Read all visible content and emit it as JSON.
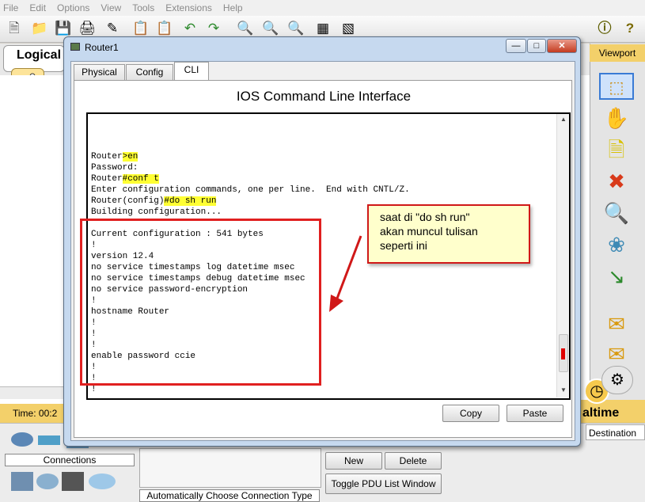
{
  "menu": [
    "File",
    "Edit",
    "Options",
    "View",
    "Tools",
    "Extensions",
    "Help"
  ],
  "workspace": {
    "logical_tab": "Logical",
    "viewport_label": "Viewport",
    "time_label": "Time: 00:2",
    "realtime_label": "altime",
    "destination_label": "Destination",
    "connections_label": "Connections",
    "auto_connection_label": "Automatically Choose Connection Type",
    "new_button": "New",
    "delete_button": "Delete",
    "toggle_pdu_button": "Toggle PDU List Window"
  },
  "window": {
    "title": "Router1",
    "tabs": [
      "Physical",
      "Config",
      "CLI"
    ],
    "active_tab": "CLI",
    "cli_header": "IOS Command Line Interface",
    "copy_button": "Copy",
    "paste_button": "Paste"
  },
  "cli_lines": [
    {
      "prefix": "",
      "hl": "",
      "suffix": ""
    },
    {
      "prefix": "",
      "hl": "",
      "suffix": ""
    },
    {
      "prefix": "",
      "hl": "",
      "suffix": ""
    },
    {
      "prefix": "Router",
      "hl": ">en",
      "suffix": ""
    },
    {
      "prefix": "Password:",
      "hl": "",
      "suffix": ""
    },
    {
      "prefix": "Router",
      "hl": "#conf t",
      "suffix": ""
    },
    {
      "prefix": "Enter configuration commands, one per line.  End with CNTL/Z.",
      "hl": "",
      "suffix": ""
    },
    {
      "prefix": "Router(config)",
      "hl": "#do sh run",
      "suffix": ""
    },
    {
      "prefix": "Building configuration...",
      "hl": "",
      "suffix": ""
    },
    {
      "prefix": "",
      "hl": "",
      "suffix": ""
    },
    {
      "prefix": "Current configuration : 541 bytes",
      "hl": "",
      "suffix": ""
    },
    {
      "prefix": "!",
      "hl": "",
      "suffix": ""
    },
    {
      "prefix": "version 12.4",
      "hl": "",
      "suffix": ""
    },
    {
      "prefix": "no service timestamps log datetime msec",
      "hl": "",
      "suffix": ""
    },
    {
      "prefix": "no service timestamps debug datetime msec",
      "hl": "",
      "suffix": ""
    },
    {
      "prefix": "no service password-encryption",
      "hl": "",
      "suffix": ""
    },
    {
      "prefix": "!",
      "hl": "",
      "suffix": ""
    },
    {
      "prefix": "hostname Router",
      "hl": "",
      "suffix": ""
    },
    {
      "prefix": "!",
      "hl": "",
      "suffix": ""
    },
    {
      "prefix": "!",
      "hl": "",
      "suffix": ""
    },
    {
      "prefix": "!",
      "hl": "",
      "suffix": ""
    },
    {
      "prefix": "enable password ccie",
      "hl": "",
      "suffix": ""
    },
    {
      "prefix": "!",
      "hl": "",
      "suffix": ""
    },
    {
      "prefix": "!",
      "hl": "",
      "suffix": ""
    },
    {
      "prefix": "!",
      "hl": "",
      "suffix": ""
    }
  ],
  "annotation": {
    "lines": [
      "saat di \"do sh run\"",
      "akan muncul tulisan",
      "seperti ini"
    ],
    "border_color": "#d01818",
    "background": "#ffffcc"
  },
  "colors": {
    "highlight": "#ffff33",
    "accent_yellow": "#f3d06a",
    "window_frame": "#c6d9ef"
  }
}
